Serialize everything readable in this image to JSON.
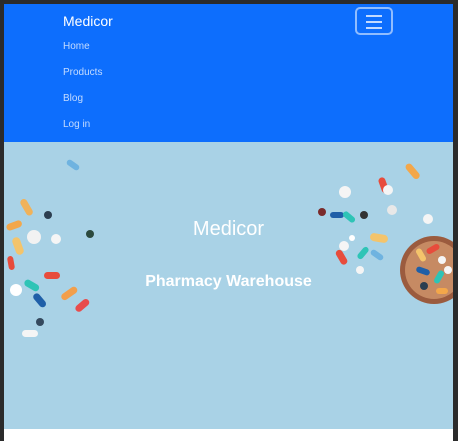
{
  "navbar": {
    "brand": "Medicor",
    "links": [
      "Home",
      "Products",
      "Blog",
      "Log in"
    ]
  },
  "hero": {
    "title": "Medicor",
    "subtitle": "Pharmacy Warehouse"
  },
  "colors": {
    "navbar": "#0d6efd",
    "hero_background": "#a9d2e6",
    "text": "#ffffff"
  },
  "icons": [
    "hamburger-menu-icon",
    "pills-illustration"
  ]
}
